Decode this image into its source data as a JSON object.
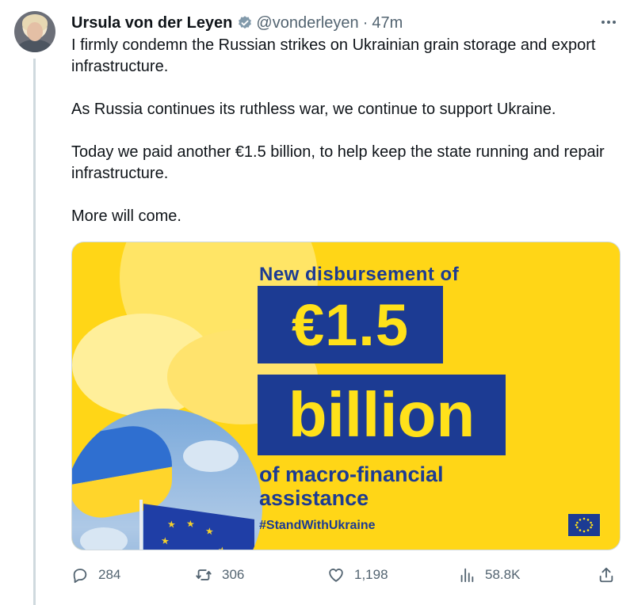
{
  "tweet": {
    "author_name": "Ursula von der Leyen",
    "handle": "@vonderleyen",
    "separator": "·",
    "time": "47m",
    "paragraphs": [
      "I firmly condemn the Russian strikes on Ukrainian grain storage and export infrastructure.",
      "As Russia continues its ruthless war, we continue to support Ukraine.",
      "Today we paid another €1.5 billion, to help keep the state running and repair infrastructure.",
      "More will come."
    ]
  },
  "media": {
    "line_new": "New disbursement of",
    "amount": "€1.5",
    "unit": "billion",
    "line_macro": "of macro-financial assistance",
    "hashtag": "#StandWithUkraine"
  },
  "actions": {
    "replies": "284",
    "retweets": "306",
    "likes": "1,198",
    "views": "58.8K"
  },
  "icons": {
    "verified": "verified-badge-icon",
    "more": "more-options-icon",
    "reply": "reply-icon",
    "retweet": "retweet-icon",
    "like": "heart-icon",
    "views": "views-chart-icon",
    "share": "share-icon"
  },
  "colors": {
    "text": "#0f1419",
    "muted": "#536471",
    "verified_badge": "#829aab",
    "eu_blue": "#1c3b93",
    "eu_yellow": "#ffe11a",
    "banner_yellow": "#ffd617"
  }
}
